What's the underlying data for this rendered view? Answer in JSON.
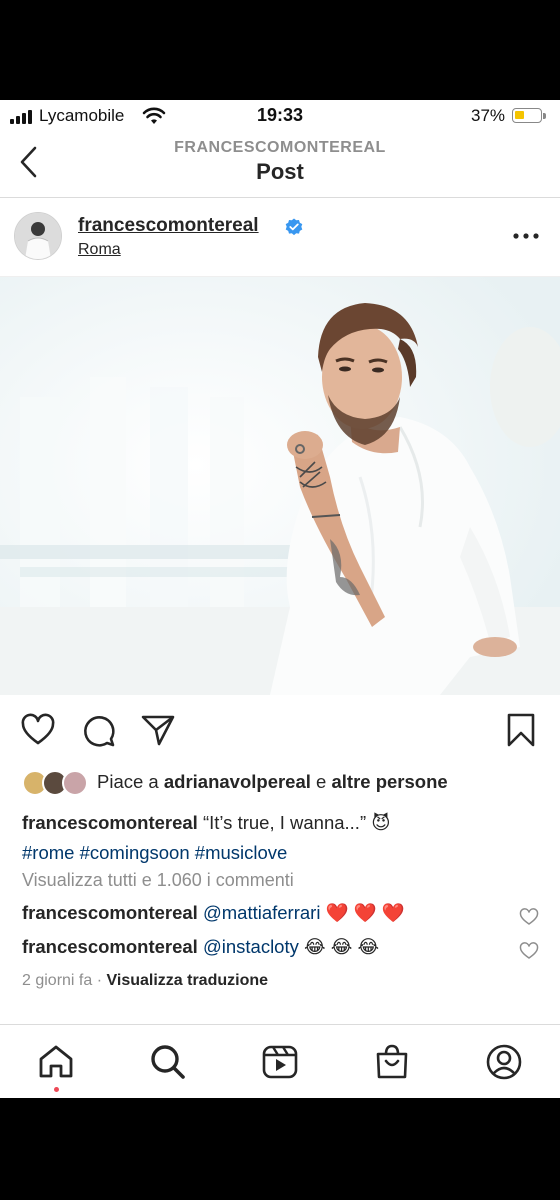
{
  "status_bar": {
    "carrier": "Lycamobile",
    "time": "19:33",
    "battery_percent": "37%",
    "battery_level": 0.37
  },
  "header": {
    "subtitle": "FRANCESCOMONTEREAL",
    "title": "Post"
  },
  "post": {
    "username": "francescomontereal",
    "location": "Roma",
    "likes": {
      "prefix": "Piace a ",
      "user": "adrianavolpereal",
      "middle": " e ",
      "others": "altre persone"
    },
    "caption": {
      "username": "francescomontereal",
      "text": " “It’s true, I wanna...”",
      "emoji": "😈",
      "hashtags": [
        "#rome",
        "#comingsoon",
        "#musiclove"
      ]
    },
    "view_comments": "Visualizza tutti e 1.060 i commenti",
    "comments": [
      {
        "username": "francescomontereal",
        "mention": "@mattiaferrari",
        "emoji": "❤️ ❤️ ❤️"
      },
      {
        "username": "francescomontereal",
        "mention": "@instacloty",
        "emoji": "😂 😂 😂"
      }
    ],
    "time_ago": "2 giorni fa",
    "separator": " · ",
    "translate": "Visualizza traduzione"
  },
  "colors": {
    "accent_link": "#00376b",
    "verified": "#3897f0",
    "notification_dot": "#ed4956",
    "battery": "#f5c400"
  },
  "icons": {
    "actions": [
      "heart-icon",
      "comment-icon",
      "share-icon",
      "bookmark-icon"
    ],
    "nav": [
      "home-icon",
      "search-icon",
      "reels-icon",
      "shop-icon",
      "profile-icon"
    ]
  }
}
